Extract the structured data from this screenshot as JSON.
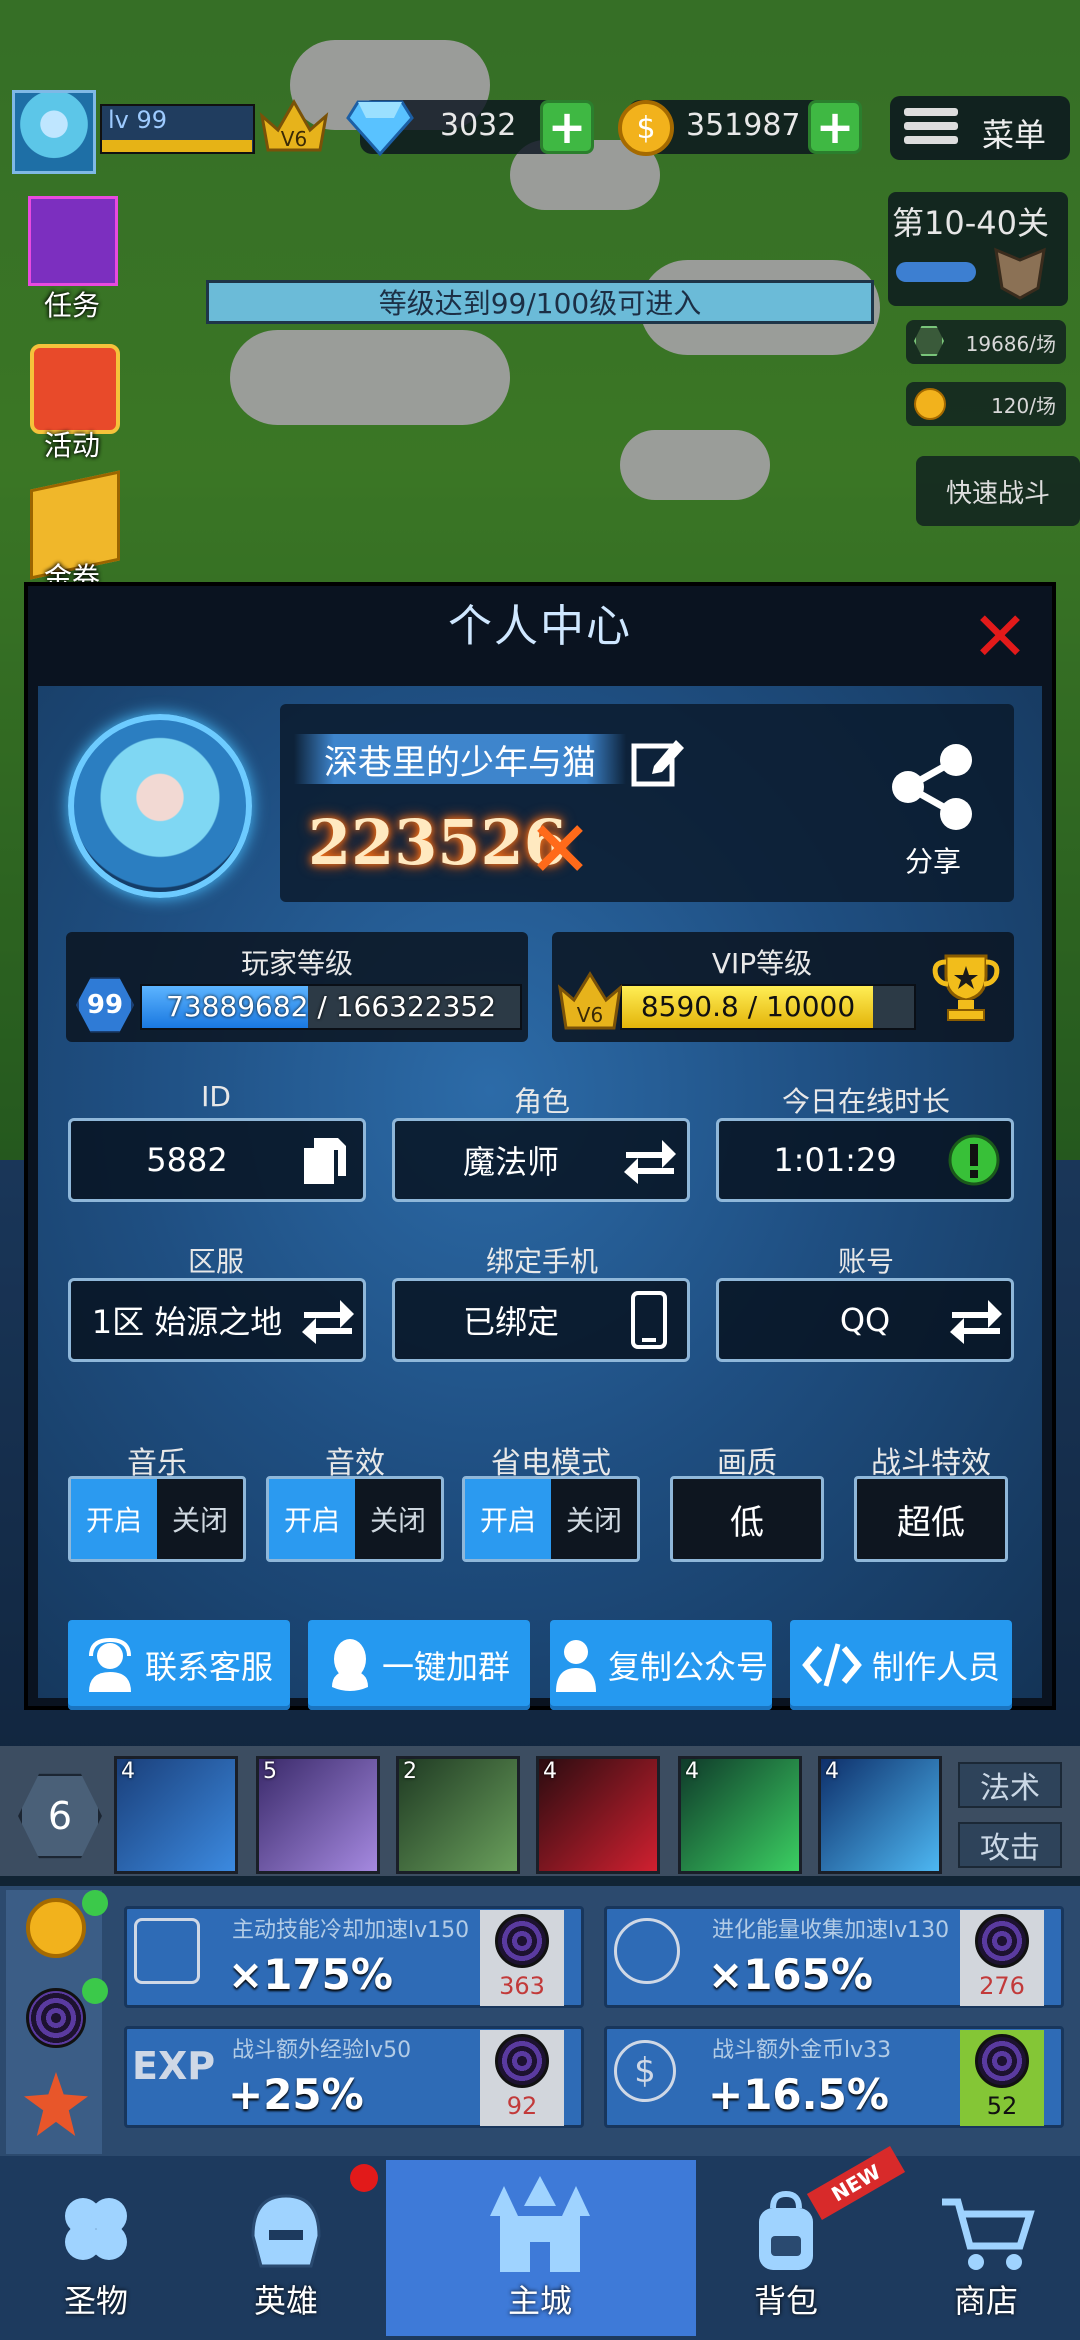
{
  "hud": {
    "player_level": "lv 99",
    "vip_badge": "V6",
    "diamonds": "3032",
    "gold": "351987",
    "menu_label": "菜单"
  },
  "side_menu": [
    {
      "label": "任务",
      "icon": "scroll-icon"
    },
    {
      "label": "活动",
      "icon": "gift-icon"
    },
    {
      "label": "金券",
      "icon": "ticket-icon"
    }
  ],
  "level_gate": "等级达到99/100级可进入",
  "stage": {
    "label": "第10-40关",
    "exp_rate": "19686/场",
    "gold_rate": "120/场",
    "fast_battle": "快速战斗"
  },
  "dialog": {
    "title": "个人中心",
    "player_name": "深巷里的少年与猫",
    "power": "223526",
    "share_label": "分享",
    "player_level": {
      "title": "玩家等级",
      "badge": "99",
      "progress_text": "73889682 / 166322352",
      "progress": 0.44
    },
    "vip_level": {
      "title": "VIP等级",
      "badge": "V6",
      "progress_text": "8590.8 / 10000",
      "progress": 0.86
    },
    "fields": [
      {
        "label": "ID",
        "value": "5882",
        "icon": "copy-icon"
      },
      {
        "label": "角色",
        "value": "魔法师",
        "icon": "swap-icon"
      },
      {
        "label": "今日在线时长",
        "value": "1:01:29",
        "icon": "info-alert-icon"
      },
      {
        "label": "区服",
        "value": "1区 始源之地",
        "icon": "swap-icon"
      },
      {
        "label": "绑定手机",
        "value": "已绑定",
        "icon": "phone-icon"
      },
      {
        "label": "账号",
        "value": "QQ",
        "icon": "swap-icon"
      }
    ],
    "settings": {
      "music": {
        "label": "音乐",
        "on": "开启",
        "off": "关闭"
      },
      "sound": {
        "label": "音效",
        "on": "开启",
        "off": "关闭"
      },
      "power_save": {
        "label": "省电模式",
        "on": "开启",
        "off": "关闭"
      },
      "quality": {
        "label": "画质",
        "value": "低"
      },
      "effects": {
        "label": "战斗特效",
        "value": "超低"
      }
    },
    "actions": [
      {
        "label": "联系客服",
        "icon": "support-agent-icon"
      },
      {
        "label": "一键加群",
        "icon": "penguin-icon"
      },
      {
        "label": "复制公众号",
        "icon": "person-icon"
      },
      {
        "label": "制作人员",
        "icon": "code-tools-icon"
      }
    ]
  },
  "skills": {
    "slot_count": "6",
    "levels": [
      "4",
      "5",
      "2",
      "4",
      "4",
      "4"
    ],
    "tab_magic": "法术",
    "tab_attack": "攻击"
  },
  "boosts": [
    {
      "title": "主动技能冷却加速lv150",
      "value": "×175%",
      "cost": "363"
    },
    {
      "title": "进化能量收集加速lv130",
      "value": "×165%",
      "cost": "276"
    },
    {
      "title": "战斗额外经验lv50",
      "value": "+25%",
      "cost": "92"
    },
    {
      "title": "战斗额外金币lv33",
      "value": "+16.5%",
      "cost": "52"
    }
  ],
  "bottom_nav": [
    {
      "label": "圣物",
      "icon": "clover-icon"
    },
    {
      "label": "英雄",
      "icon": "helmet-icon"
    },
    {
      "label": "主城",
      "icon": "castle-icon"
    },
    {
      "label": "背包",
      "icon": "backpack-icon"
    },
    {
      "label": "商店",
      "icon": "cart-icon"
    }
  ],
  "new_badge": "NEW",
  "colors": {
    "accent": "#2599f0",
    "close": "#e21a1a",
    "gold": "#e3b40a"
  }
}
